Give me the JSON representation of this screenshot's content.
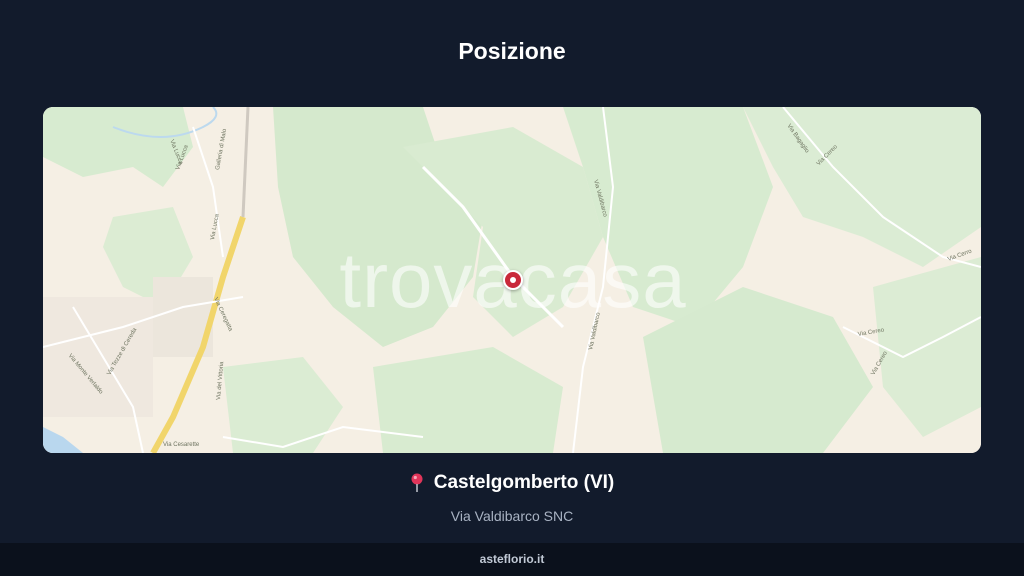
{
  "page": {
    "title": "Posizione"
  },
  "map": {
    "watermark": "trovacasa",
    "streets": [
      "Via Lucca",
      "Galleria di Malo",
      "Via Lucca",
      "Via Lucca",
      "Via Ceregatta",
      "Via Monte Verlaldo",
      "Via Tezze di Cereda",
      "Via del Vittoria",
      "Via Cesarette",
      "Via Valdibarco",
      "Via Valdibarco",
      "Via Cereo",
      "Via Cereo",
      "Via Cereo",
      "Via Cerro",
      "Via Bagaglio"
    ]
  },
  "location": {
    "icon": "map-pin-icon",
    "name": "Castelgomberto (VI)",
    "address": "Via Valdibarco SNC"
  },
  "footer": {
    "brand": "asteflorio.it"
  },
  "colors": {
    "background": "#121b2c",
    "footer": "#0b111c",
    "pin": "#c9283a",
    "map_green": "#d7ebd0",
    "map_base": "#f5efe4"
  }
}
